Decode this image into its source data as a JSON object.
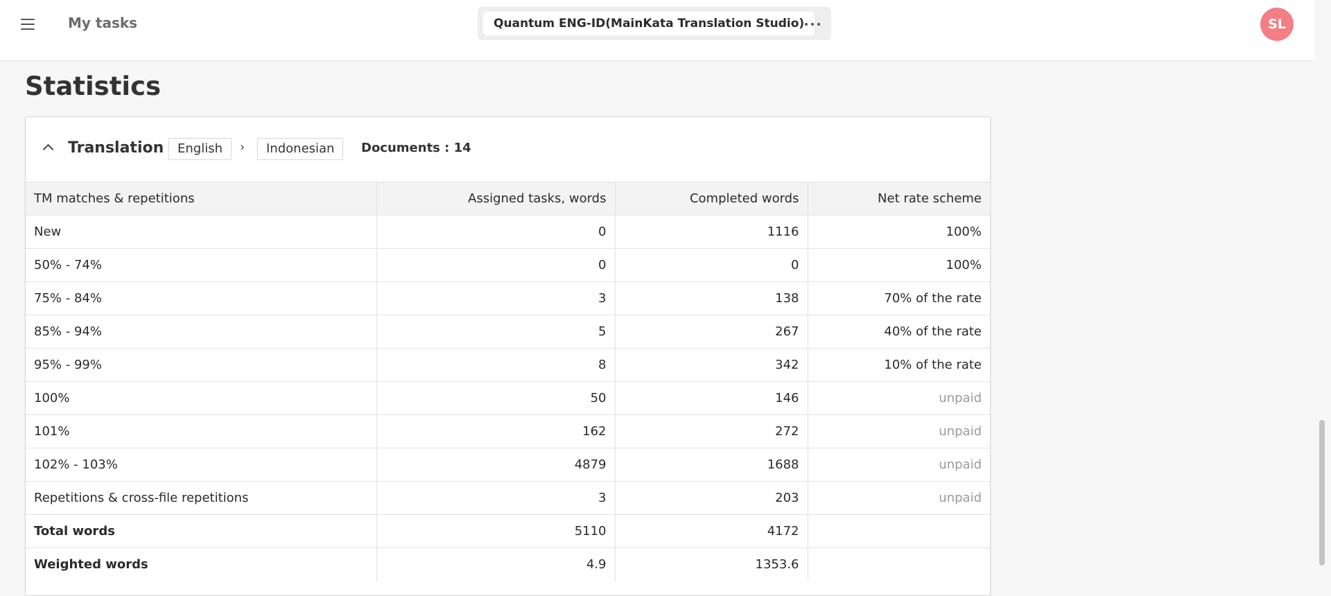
{
  "header": {
    "nav_title": "My tasks",
    "project_name": "Quantum ENG-ID(MainKata Translation Studio)",
    "avatar_initials": "SL",
    "avatar_color": "#f27e86",
    "icons": [
      "menu-icon",
      "more-options-icon"
    ]
  },
  "page": {
    "title": "Statistics"
  },
  "panel": {
    "section": "Translation",
    "source_lang": "English",
    "arrow": "›",
    "target_lang": "Indonesian",
    "documents": "Documents : 14"
  },
  "table": {
    "headers": [
      "TM matches & repetitions",
      "Assigned tasks, words",
      "Completed words",
      "Net rate scheme"
    ],
    "rows": [
      {
        "label": "New",
        "assigned": "0",
        "completed": "1116",
        "rate": "100%"
      },
      {
        "label": "50% - 74%",
        "assigned": "0",
        "completed": "0",
        "rate": "100%"
      },
      {
        "label": "75% - 84%",
        "assigned": "3",
        "completed": "138",
        "rate": "70% of the rate"
      },
      {
        "label": "85% - 94%",
        "assigned": "5",
        "completed": "267",
        "rate": "40% of the rate"
      },
      {
        "label": "95% - 99%",
        "assigned": "8",
        "completed": "342",
        "rate": "10% of the rate"
      },
      {
        "label": "100%",
        "assigned": "50",
        "completed": "146",
        "rate": "unpaid"
      },
      {
        "label": "101%",
        "assigned": "162",
        "completed": "272",
        "rate": "unpaid"
      },
      {
        "label": "102% - 103%",
        "assigned": "4879",
        "completed": "1688",
        "rate": "unpaid"
      },
      {
        "label": "Repetitions & cross-file repetitions",
        "assigned": "3",
        "completed": "203",
        "rate": "unpaid"
      }
    ],
    "totals": [
      {
        "label": "Total words",
        "assigned": "5110",
        "completed": "4172",
        "rate": ""
      },
      {
        "label": "Weighted words",
        "assigned": "4.9",
        "completed": "1353.6",
        "rate": ""
      }
    ]
  }
}
